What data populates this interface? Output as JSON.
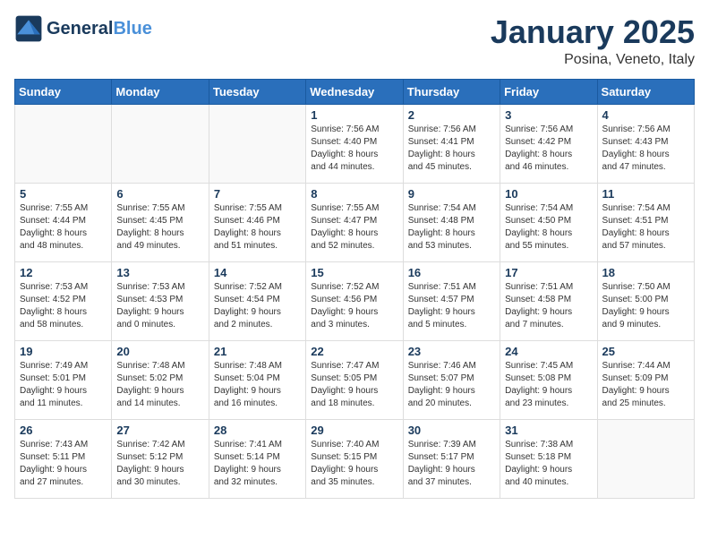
{
  "header": {
    "logo_line1": "General",
    "logo_line2": "Blue",
    "month": "January 2025",
    "location": "Posina, Veneto, Italy"
  },
  "weekdays": [
    "Sunday",
    "Monday",
    "Tuesday",
    "Wednesday",
    "Thursday",
    "Friday",
    "Saturday"
  ],
  "weeks": [
    [
      {
        "day": "",
        "info": ""
      },
      {
        "day": "",
        "info": ""
      },
      {
        "day": "",
        "info": ""
      },
      {
        "day": "1",
        "info": "Sunrise: 7:56 AM\nSunset: 4:40 PM\nDaylight: 8 hours\nand 44 minutes."
      },
      {
        "day": "2",
        "info": "Sunrise: 7:56 AM\nSunset: 4:41 PM\nDaylight: 8 hours\nand 45 minutes."
      },
      {
        "day": "3",
        "info": "Sunrise: 7:56 AM\nSunset: 4:42 PM\nDaylight: 8 hours\nand 46 minutes."
      },
      {
        "day": "4",
        "info": "Sunrise: 7:56 AM\nSunset: 4:43 PM\nDaylight: 8 hours\nand 47 minutes."
      }
    ],
    [
      {
        "day": "5",
        "info": "Sunrise: 7:55 AM\nSunset: 4:44 PM\nDaylight: 8 hours\nand 48 minutes."
      },
      {
        "day": "6",
        "info": "Sunrise: 7:55 AM\nSunset: 4:45 PM\nDaylight: 8 hours\nand 49 minutes."
      },
      {
        "day": "7",
        "info": "Sunrise: 7:55 AM\nSunset: 4:46 PM\nDaylight: 8 hours\nand 51 minutes."
      },
      {
        "day": "8",
        "info": "Sunrise: 7:55 AM\nSunset: 4:47 PM\nDaylight: 8 hours\nand 52 minutes."
      },
      {
        "day": "9",
        "info": "Sunrise: 7:54 AM\nSunset: 4:48 PM\nDaylight: 8 hours\nand 53 minutes."
      },
      {
        "day": "10",
        "info": "Sunrise: 7:54 AM\nSunset: 4:50 PM\nDaylight: 8 hours\nand 55 minutes."
      },
      {
        "day": "11",
        "info": "Sunrise: 7:54 AM\nSunset: 4:51 PM\nDaylight: 8 hours\nand 57 minutes."
      }
    ],
    [
      {
        "day": "12",
        "info": "Sunrise: 7:53 AM\nSunset: 4:52 PM\nDaylight: 8 hours\nand 58 minutes."
      },
      {
        "day": "13",
        "info": "Sunrise: 7:53 AM\nSunset: 4:53 PM\nDaylight: 9 hours\nand 0 minutes."
      },
      {
        "day": "14",
        "info": "Sunrise: 7:52 AM\nSunset: 4:54 PM\nDaylight: 9 hours\nand 2 minutes."
      },
      {
        "day": "15",
        "info": "Sunrise: 7:52 AM\nSunset: 4:56 PM\nDaylight: 9 hours\nand 3 minutes."
      },
      {
        "day": "16",
        "info": "Sunrise: 7:51 AM\nSunset: 4:57 PM\nDaylight: 9 hours\nand 5 minutes."
      },
      {
        "day": "17",
        "info": "Sunrise: 7:51 AM\nSunset: 4:58 PM\nDaylight: 9 hours\nand 7 minutes."
      },
      {
        "day": "18",
        "info": "Sunrise: 7:50 AM\nSunset: 5:00 PM\nDaylight: 9 hours\nand 9 minutes."
      }
    ],
    [
      {
        "day": "19",
        "info": "Sunrise: 7:49 AM\nSunset: 5:01 PM\nDaylight: 9 hours\nand 11 minutes."
      },
      {
        "day": "20",
        "info": "Sunrise: 7:48 AM\nSunset: 5:02 PM\nDaylight: 9 hours\nand 14 minutes."
      },
      {
        "day": "21",
        "info": "Sunrise: 7:48 AM\nSunset: 5:04 PM\nDaylight: 9 hours\nand 16 minutes."
      },
      {
        "day": "22",
        "info": "Sunrise: 7:47 AM\nSunset: 5:05 PM\nDaylight: 9 hours\nand 18 minutes."
      },
      {
        "day": "23",
        "info": "Sunrise: 7:46 AM\nSunset: 5:07 PM\nDaylight: 9 hours\nand 20 minutes."
      },
      {
        "day": "24",
        "info": "Sunrise: 7:45 AM\nSunset: 5:08 PM\nDaylight: 9 hours\nand 23 minutes."
      },
      {
        "day": "25",
        "info": "Sunrise: 7:44 AM\nSunset: 5:09 PM\nDaylight: 9 hours\nand 25 minutes."
      }
    ],
    [
      {
        "day": "26",
        "info": "Sunrise: 7:43 AM\nSunset: 5:11 PM\nDaylight: 9 hours\nand 27 minutes."
      },
      {
        "day": "27",
        "info": "Sunrise: 7:42 AM\nSunset: 5:12 PM\nDaylight: 9 hours\nand 30 minutes."
      },
      {
        "day": "28",
        "info": "Sunrise: 7:41 AM\nSunset: 5:14 PM\nDaylight: 9 hours\nand 32 minutes."
      },
      {
        "day": "29",
        "info": "Sunrise: 7:40 AM\nSunset: 5:15 PM\nDaylight: 9 hours\nand 35 minutes."
      },
      {
        "day": "30",
        "info": "Sunrise: 7:39 AM\nSunset: 5:17 PM\nDaylight: 9 hours\nand 37 minutes."
      },
      {
        "day": "31",
        "info": "Sunrise: 7:38 AM\nSunset: 5:18 PM\nDaylight: 9 hours\nand 40 minutes."
      },
      {
        "day": "",
        "info": ""
      }
    ]
  ]
}
